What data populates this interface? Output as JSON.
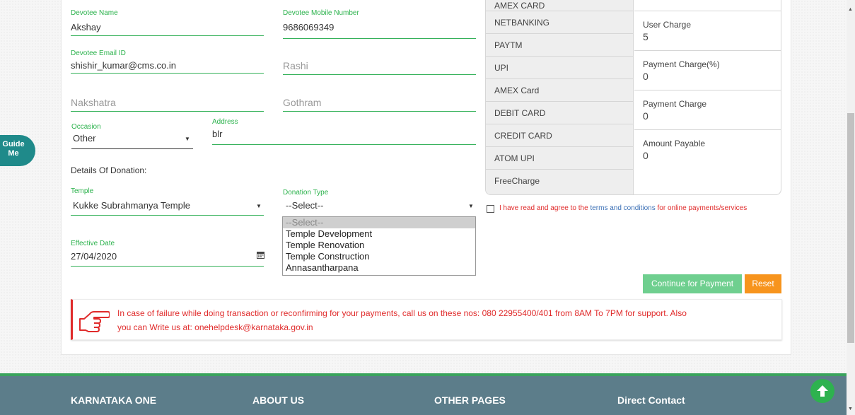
{
  "guide_me": "Guide Me",
  "form": {
    "devotee_name": {
      "label": "Devotee Name",
      "value": "Akshay"
    },
    "devotee_mobile": {
      "label": "Devotee Mobile Number",
      "value": "9686069349"
    },
    "devotee_email": {
      "label": "Devotee Email ID",
      "value": "shishir_kumar@cms.co.in"
    },
    "rashi": {
      "placeholder": "Rashi"
    },
    "nakshatra": {
      "placeholder": "Nakshatra"
    },
    "gothram": {
      "placeholder": "Gothram"
    },
    "occasion": {
      "label": "Occasion",
      "value": "Other"
    },
    "address": {
      "label": "Address",
      "value": "blr"
    },
    "details_heading": "Details Of Donation:",
    "temple": {
      "label": "Temple",
      "value": "Kukke Subrahmanya Temple"
    },
    "donation_type": {
      "label": "Donation Type",
      "value": "--Select--",
      "options": [
        "--Select--",
        "Temple Development",
        "Temple Renovation",
        "Temple Construction",
        "Annasantharpana"
      ]
    },
    "effective_date": {
      "label": "Effective Date",
      "value": "27/04/2020"
    }
  },
  "payment_methods": [
    "AMEX CARD",
    "NETBANKING",
    "PAYTM",
    "UPI",
    "AMEX Card",
    "DEBIT CARD",
    "CREDIT CARD",
    "ATOM UPI",
    "FreeCharge"
  ],
  "charges": [
    {
      "label": "User Charge",
      "value": "5"
    },
    {
      "label": "Payment Charge(%)",
      "value": "0"
    },
    {
      "label": "Payment Charge",
      "value": "0"
    },
    {
      "label": "Amount Payable",
      "value": "0"
    }
  ],
  "terms": {
    "prefix": "I have read and agree to the ",
    "link": "terms and conditions",
    "suffix": " for online payments/services"
  },
  "buttons": {
    "continue": "Continue for Payment",
    "reset": "Reset"
  },
  "notice": {
    "line1": "In case of failure while doing transaction or reconfirming for your payments, call us on these nos: 080 22955400/401 from 8AM To 7PM for support. Also",
    "line2": "you can Write us at: onehelpdesk@karnataka.gov.in"
  },
  "footer": {
    "col1": "KARNATAKA ONE",
    "col2": "ABOUT US",
    "col3": "OTHER PAGES",
    "col4": "Direct Contact"
  },
  "colors": {
    "accent_green": "#34b159",
    "reset_orange": "#f7941d",
    "continue_green": "#6fcf8f",
    "notice_red": "#e02b2b",
    "footer": "#5c7d8a",
    "guide_teal": "#1f8a8a"
  }
}
